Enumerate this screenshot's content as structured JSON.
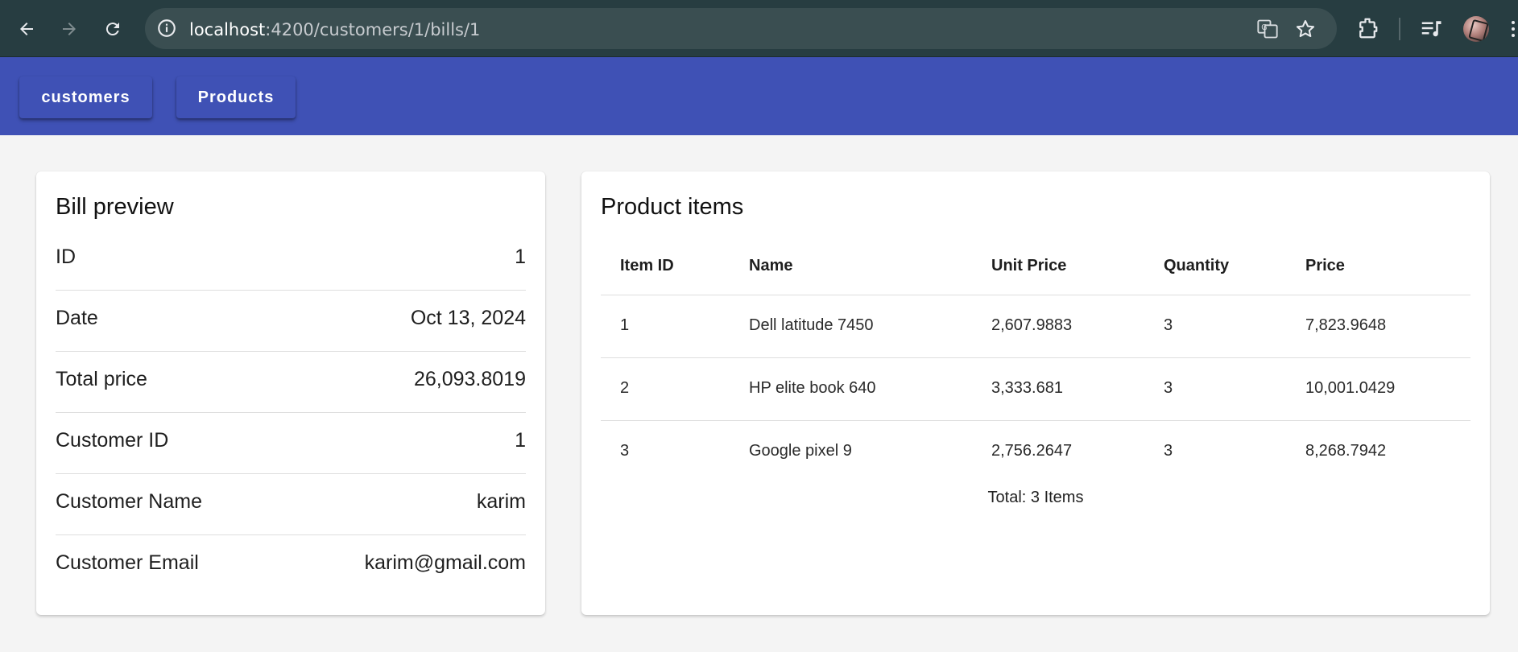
{
  "browser": {
    "url_host": "localhost",
    "url_path": ":4200/customers/1/bills/1",
    "icons": [
      "back-icon",
      "forward-icon",
      "reload-icon",
      "site-info-icon",
      "translate-icon",
      "bookmark-star-icon",
      "extensions-icon",
      "media-control-icon",
      "profile-avatar",
      "more-menu-icon"
    ]
  },
  "toolbar": {
    "buttons": [
      {
        "label": "customers"
      },
      {
        "label": "Products"
      }
    ],
    "color": "#3f51b5"
  },
  "bill": {
    "title": "Bill preview",
    "rows": [
      {
        "label": "ID",
        "value": "1"
      },
      {
        "label": "Date",
        "value": "Oct 13, 2024"
      },
      {
        "label": "Total price",
        "value": "26,093.8019"
      },
      {
        "label": "Customer ID",
        "value": "1"
      },
      {
        "label": "Customer Name",
        "value": "karim"
      },
      {
        "label": "Customer Email",
        "value": "karim@gmail.com"
      }
    ]
  },
  "products": {
    "title": "Product items",
    "columns": [
      "Item ID",
      "Name",
      "Unit Price",
      "Quantity",
      "Price"
    ],
    "rows": [
      [
        "1",
        "Dell latitude 7450",
        "2,607.9883",
        "3",
        "7,823.9648"
      ],
      [
        "2",
        "HP elite book 640",
        "3,333.681",
        "3",
        "10,001.0429"
      ],
      [
        "3",
        "Google pixel 9",
        "2,756.2647",
        "3",
        "8,268.7942"
      ]
    ],
    "total_label": "Total: 3 Items"
  }
}
